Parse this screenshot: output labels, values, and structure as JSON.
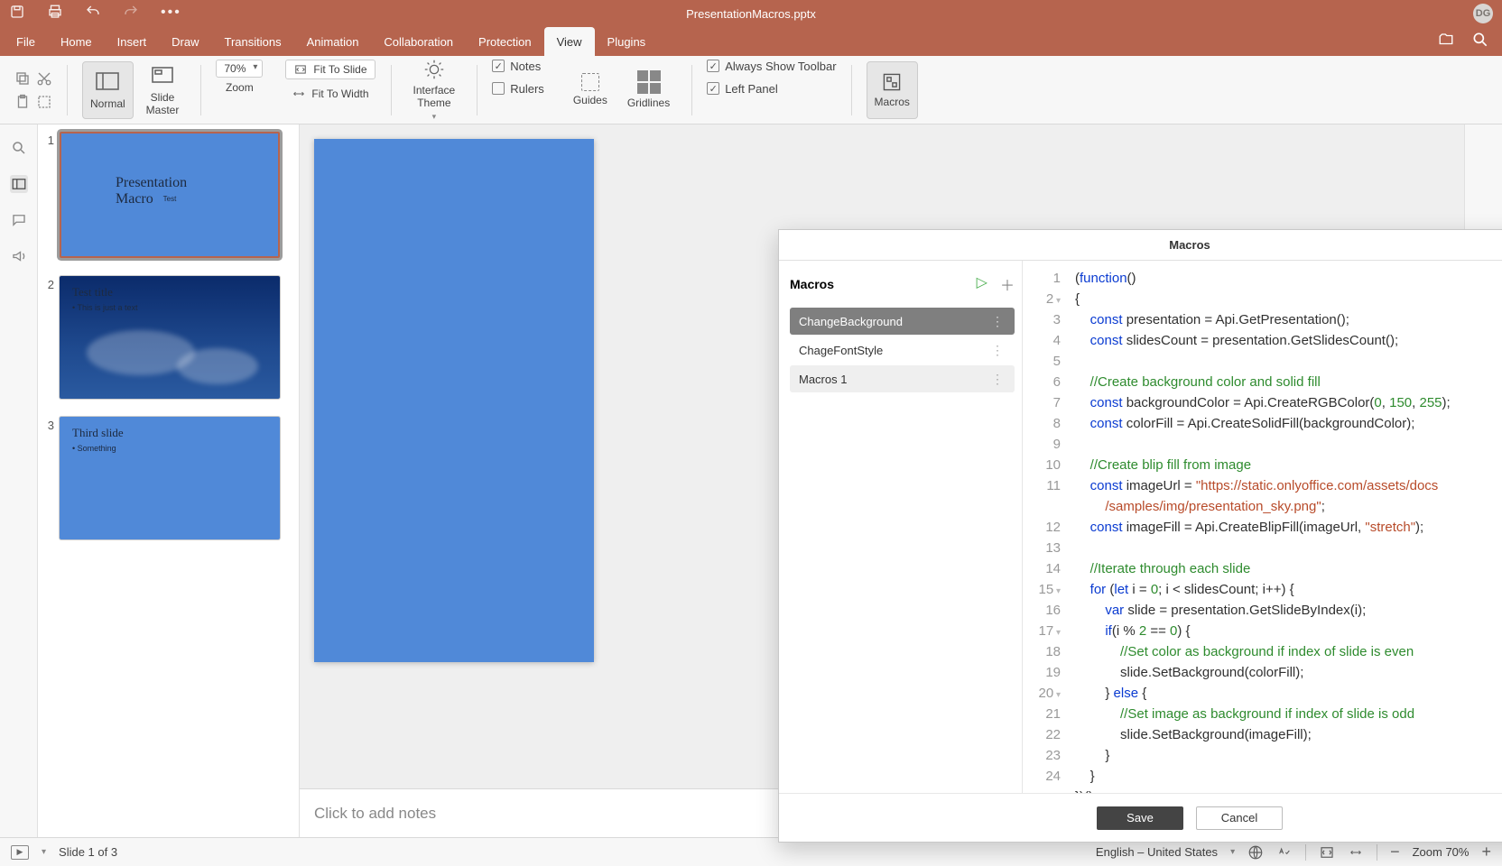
{
  "titlebar": {
    "doc_title": "PresentationMacros.pptx",
    "avatar": "DG"
  },
  "menu": {
    "tabs": [
      "File",
      "Home",
      "Insert",
      "Draw",
      "Transitions",
      "Animation",
      "Collaboration",
      "Protection",
      "View",
      "Plugins"
    ],
    "active_index": 8
  },
  "ribbon": {
    "normal": "Normal",
    "slide_master": "Slide\nMaster",
    "zoom_value": "70%",
    "zoom_label": "Zoom",
    "fit_slide": "Fit To Slide",
    "fit_width": "Fit To Width",
    "interface_theme": "Interface\nTheme",
    "notes": "Notes",
    "rulers": "Rulers",
    "guides": "Guides",
    "gridlines": "Gridlines",
    "always_toolbar": "Always Show Toolbar",
    "left_panel": "Left Panel",
    "macros": "Macros"
  },
  "slides": {
    "s1": {
      "num": "1",
      "title": "Presentation Macro",
      "sub": "Test"
    },
    "s2": {
      "num": "2",
      "title": "Test title",
      "bullet": "• This is just a text"
    },
    "s3": {
      "num": "3",
      "title": "Third slide",
      "bullet": "• Something"
    }
  },
  "notes_placeholder": "Click to add notes",
  "dialog": {
    "title": "Macros",
    "list_header": "Macros",
    "items": [
      "ChangeBackground",
      "ChageFontStyle",
      "Macros 1"
    ],
    "save": "Save",
    "cancel": "Cancel",
    "code_lines": [
      "(function()",
      "{",
      "    const presentation = Api.GetPresentation();",
      "    const slidesCount = presentation.GetSlidesCount();",
      "",
      "    //Create background color and solid fill",
      "    const backgroundColor = Api.CreateRGBColor(0, 150, 255);",
      "    const colorFill = Api.CreateSolidFill(backgroundColor);",
      "",
      "    //Create blip fill from image",
      "    const imageUrl = \"https://static.onlyoffice.com/assets/docs",
      "        /samples/img/presentation_sky.png\";",
      "    const imageFill = Api.CreateBlipFill(imageUrl, \"stretch\");",
      "",
      "    //Iterate through each slide",
      "    for (let i = 0; i < slidesCount; i++) {",
      "        var slide = presentation.GetSlideByIndex(i);",
      "        if(i % 2 == 0) {",
      "            //Set color as background if index of slide is even",
      "            slide.SetBackground(colorFill);",
      "        } else {",
      "            //Set image as background if index of slide is odd",
      "            slide.SetBackground(imageFill);",
      "        }",
      "    }",
      "})();"
    ]
  },
  "status": {
    "slide_info": "Slide 1 of 3",
    "language": "English – United States",
    "zoom": "Zoom 70%"
  }
}
